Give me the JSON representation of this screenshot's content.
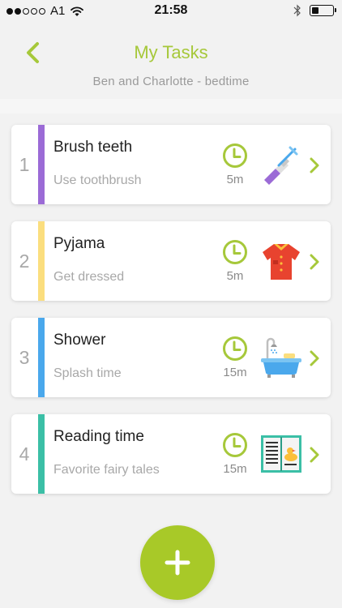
{
  "status_bar": {
    "carrier": "A1",
    "time": "21:58"
  },
  "header": {
    "title": "My Tasks",
    "subtitle": "Ben and Charlotte - bedtime",
    "back_icon": "chevron-left-icon",
    "accent_color": "#a6c83a"
  },
  "tasks": [
    {
      "number": "1",
      "title": "Brush teeth",
      "description": "Use toothbrush",
      "duration": "5m",
      "color": "#9b6bd6",
      "icon": "toothbrush-icon"
    },
    {
      "number": "2",
      "title": "Pyjama",
      "description": "Get dressed",
      "duration": "5m",
      "color": "#fbde7e",
      "icon": "shirt-icon"
    },
    {
      "number": "3",
      "title": "Shower",
      "description": "Splash time",
      "duration": "15m",
      "color": "#4aa8ec",
      "icon": "bathtub-icon"
    },
    {
      "number": "4",
      "title": "Reading time",
      "description": "Favorite fairy tales",
      "duration": "15m",
      "color": "#3bbfa6",
      "icon": "book-icon"
    }
  ],
  "fab": {
    "icon": "plus-icon",
    "color": "#a8c928"
  }
}
